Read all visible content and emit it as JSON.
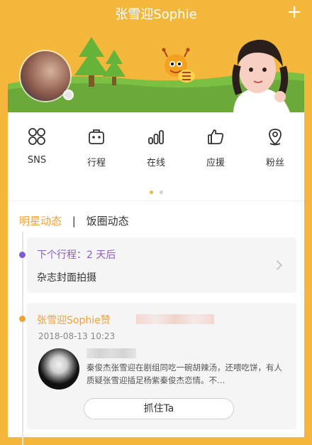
{
  "header": {
    "title": "张雪迎Sophie",
    "add_button": "+"
  },
  "banner": {
    "avatar_icon": "profile-avatar",
    "online_indicator_icon": "status-dot"
  },
  "menu": {
    "items": [
      {
        "label": "SNS",
        "icon": "four-circles-icon"
      },
      {
        "label": "行程",
        "icon": "suitcase-icon"
      },
      {
        "label": "在线",
        "icon": "signal-bars-icon"
      },
      {
        "label": "应援",
        "icon": "thumbs-up-icon"
      },
      {
        "label": "粉丝",
        "icon": "location-pin-icon"
      }
    ],
    "page_dots": {
      "active_color": "#f3b73c",
      "inactive_color": "#d0d0d0"
    }
  },
  "tabs": {
    "active": "明星动态",
    "separator": "|",
    "inactive": "饭圈动态"
  },
  "schedule": {
    "title": "下个行程：2 天后",
    "subtitle": "杂志封面拍摄"
  },
  "feed": {
    "title": "张雪迎Sophie赞",
    "time": "2018-08-13 10:23",
    "description": "秦俊杰张雪迎在剧组同吃一碗胡辣汤，还喂吃饼，有人质疑张雪迎插足杨紫秦俊杰恋情。不…",
    "cta": "抓住Ta"
  },
  "colors": {
    "background": "#f3b73c",
    "accent": "#f0a23a",
    "schedule_title": "#8a5cc8",
    "timeline_purple": "#7b5ed6",
    "timeline_orange": "#f0a23a"
  }
}
